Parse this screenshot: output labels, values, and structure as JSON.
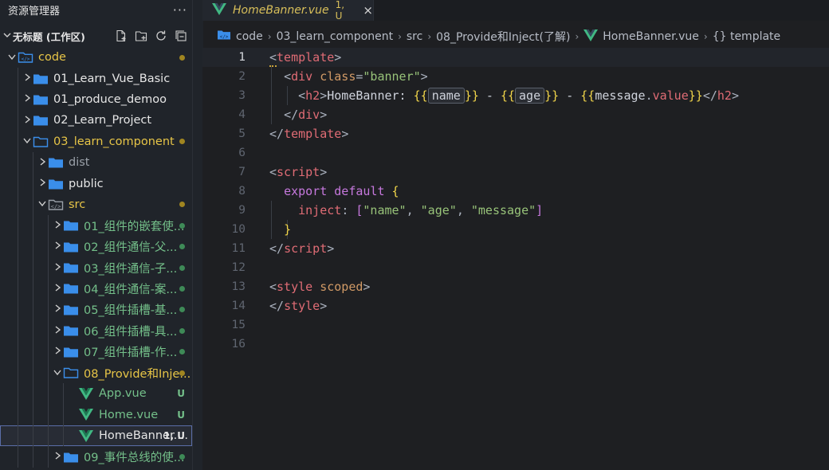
{
  "sidebar": {
    "title": "资源管理器",
    "menu_icon": "ellipsis-icon",
    "workspace": "无标题 (工作区)",
    "items": [
      {
        "label": "code",
        "depth": 0,
        "type": "folder-root",
        "open": true,
        "color": "#e7c547",
        "status": "dot",
        "dot_color": "#a08520"
      },
      {
        "label": "01_Learn_Vue_Basic",
        "depth": 1,
        "type": "folder",
        "open": false,
        "color": "#e6e6e6"
      },
      {
        "label": "01_produce_demoo",
        "depth": 1,
        "type": "folder",
        "open": false,
        "color": "#e6e6e6"
      },
      {
        "label": "02_Learn_Project",
        "depth": 1,
        "type": "folder",
        "open": false,
        "color": "#e6e6e6"
      },
      {
        "label": "03_learn_component",
        "depth": 1,
        "type": "folder",
        "open": true,
        "color": "#e7c547",
        "status": "dot",
        "dot_color": "#a08520"
      },
      {
        "label": "dist",
        "depth": 2,
        "type": "folder",
        "open": false,
        "color": "#9aa0a8"
      },
      {
        "label": "public",
        "depth": 2,
        "type": "folder",
        "open": false,
        "color": "#e6e6e6"
      },
      {
        "label": "src",
        "depth": 2,
        "type": "folder-src",
        "open": true,
        "color": "#e7c547",
        "status": "dot",
        "dot_color": "#a08520"
      },
      {
        "label": "01_组件的嵌套使...",
        "depth": 3,
        "type": "folder",
        "open": false,
        "color": "#74c08a",
        "status": "dot",
        "dot_color": "#3e8a57"
      },
      {
        "label": "02_组件通信-父...",
        "depth": 3,
        "type": "folder",
        "open": false,
        "color": "#74c08a",
        "status": "dot",
        "dot_color": "#3e8a57"
      },
      {
        "label": "03_组件通信-子...",
        "depth": 3,
        "type": "folder",
        "open": false,
        "color": "#74c08a",
        "status": "dot",
        "dot_color": "#3e8a57"
      },
      {
        "label": "04_组件通信-案...",
        "depth": 3,
        "type": "folder",
        "open": false,
        "color": "#74c08a",
        "status": "dot",
        "dot_color": "#3e8a57"
      },
      {
        "label": "05_组件插槽-基...",
        "depth": 3,
        "type": "folder",
        "open": false,
        "color": "#74c08a",
        "status": "dot",
        "dot_color": "#3e8a57"
      },
      {
        "label": "06_组件插槽-具...",
        "depth": 3,
        "type": "folder",
        "open": false,
        "color": "#74c08a",
        "status": "dot",
        "dot_color": "#3e8a57"
      },
      {
        "label": "07_组件插槽-作...",
        "depth": 3,
        "type": "folder",
        "open": false,
        "color": "#74c08a",
        "status": "dot",
        "dot_color": "#3e8a57"
      },
      {
        "label": "08_Provide和Inje...",
        "depth": 3,
        "type": "folder",
        "open": true,
        "color": "#e7c547",
        "status": "dot",
        "dot_color": "#a08520"
      },
      {
        "label": "App.vue",
        "depth": 4,
        "type": "vue",
        "color": "#74c08a",
        "status": "U",
        "badge_color": "#74c08a"
      },
      {
        "label": "Home.vue",
        "depth": 4,
        "type": "vue",
        "color": "#74c08a",
        "status": "U",
        "badge_color": "#74c08a"
      },
      {
        "label": "HomeBanner....",
        "depth": 4,
        "type": "vue",
        "color": "#e6e6e6",
        "status": "1, U",
        "badge_color": "#e6e6e6",
        "active": true
      },
      {
        "label": "09_事件总线的使...",
        "depth": 3,
        "type": "folder",
        "open": false,
        "color": "#74c08a",
        "status": "dot",
        "dot_color": "#3e8a57"
      }
    ]
  },
  "tab": {
    "name": "HomeBanner.vue",
    "status": "1, U",
    "close": "×"
  },
  "breadcrumb": [
    "code",
    "03_learn_component",
    "src",
    "08_Provide和Inject(了解)",
    "HomeBanner.vue",
    "{} template"
  ],
  "editor": {
    "current_line": 1,
    "line_numbers": [
      "1",
      "2",
      "3",
      "4",
      "5",
      "6",
      "7",
      "8",
      "9",
      "10",
      "11",
      "12",
      "13",
      "14",
      "15",
      "16"
    ]
  },
  "colors": {
    "folder_blue": "#3b8eea",
    "vue_green": "#41b883",
    "modified": "#e7c547",
    "untracked": "#74c08a"
  }
}
